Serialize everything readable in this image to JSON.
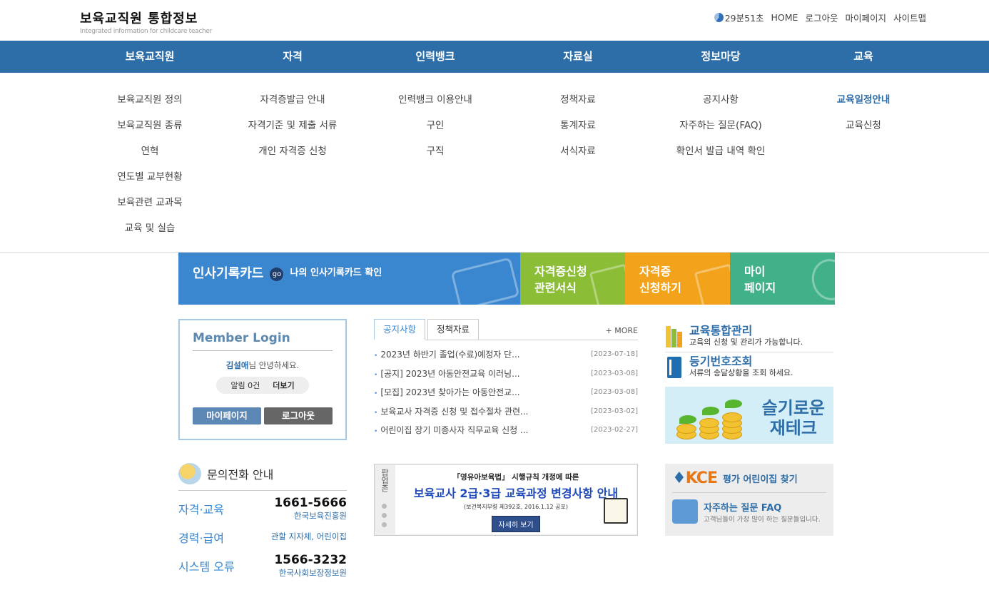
{
  "header": {
    "logo_title": "보육교직원 통합정보",
    "logo_sub": "Integrated information for childcare teacher",
    "timer": "29분51초",
    "links": [
      "HOME",
      "로그아웃",
      "마이페이지",
      "사이트맵"
    ]
  },
  "gnb": [
    "보육교직원",
    "자격",
    "인력뱅크",
    "자료실",
    "정보마당",
    "교육"
  ],
  "mega": [
    [
      "보육교직원 정의",
      "보육교직원 종류",
      "연혁",
      "연도별 교부현황",
      "보육관련 교과목",
      "교육 및 실습"
    ],
    [
      "자격증발급 안내",
      "자격기준 및 제출 서류",
      "개인 자격증 신청"
    ],
    [
      "인력뱅크 이용안내",
      "구인",
      "구직"
    ],
    [
      "정책자료",
      "통계자료",
      "서식자료"
    ],
    [
      "공지사항",
      "자주하는 질문(FAQ)",
      "확인서 발급 내역 확인"
    ],
    [
      "교육일정안내",
      "교육신청"
    ]
  ],
  "banners": {
    "card_title": "인사기록카드",
    "card_go": "go",
    "card_sub": "나의 인사기록카드 확인",
    "tile1": [
      "자격증신청",
      "관련서식"
    ],
    "tile2": [
      "자격증",
      "신청하기"
    ],
    "tile3": [
      "마이",
      "페이지"
    ]
  },
  "login": {
    "title": "Member Login",
    "user": "김설애",
    "greet_suffix": "님 안녕하세요.",
    "alarm": "알림 0건",
    "more": "더보기",
    "mypage": "마이페이지",
    "logout": "로그아웃"
  },
  "notice": {
    "tabs": [
      "공지사항",
      "정책자료"
    ],
    "more": "+ MORE",
    "items": [
      {
        "title": "2023년 하반기 졸업(수료)예정자 단...",
        "date": "[2023-07-18]"
      },
      {
        "title": "[공지] 2023년 아동안전교육 이러닝...",
        "date": "[2023-03-08]"
      },
      {
        "title": "[모집] 2023년 찾아가는 아동안전교...",
        "date": "[2023-03-08]"
      },
      {
        "title": "보육교사 자격증 신청 및 접수절차 관련...",
        "date": "[2023-03-02]"
      },
      {
        "title": "어린이집 장기 미종사자 직무교육 신청 ...",
        "date": "[2023-02-27]"
      }
    ]
  },
  "services": [
    {
      "title": "교육통합관리",
      "desc": "교육의 신청 및 관리가 가능합니다."
    },
    {
      "title": "등기번호조회",
      "desc": "서류의 송달상황을 조회 하세요."
    }
  ],
  "money_banner": [
    "슬기로운",
    "재테크"
  ],
  "inquiry": {
    "title": "문의전화 안내",
    "rows": [
      {
        "label": "자격·교육",
        "number": "1661-5666",
        "org": "한국보육진흥원"
      },
      {
        "label": "경력·급여",
        "number": "",
        "org": "관할 지자체, 어린이집"
      },
      {
        "label": "시스템 오류",
        "number": "1566-3232",
        "org": "한국사회보장정보원"
      }
    ]
  },
  "popup": {
    "side_label": "팝업존",
    "line1": "「영유아보육법」 시행규칙 개정에 따른",
    "line2": "보육교사 2급·3급 교육과정 변경사항 안내",
    "line3": "(보건복지부령 제392호, 2016.1.12 공포)",
    "button": "자세히 보기"
  },
  "kce": {
    "logo": "KCE",
    "eval_link": "평가 어린이집 찾기",
    "faq_title": "자주하는 질문 FAQ",
    "faq_desc": "고객님들이 가장 많이 하는 질문들입니다."
  }
}
